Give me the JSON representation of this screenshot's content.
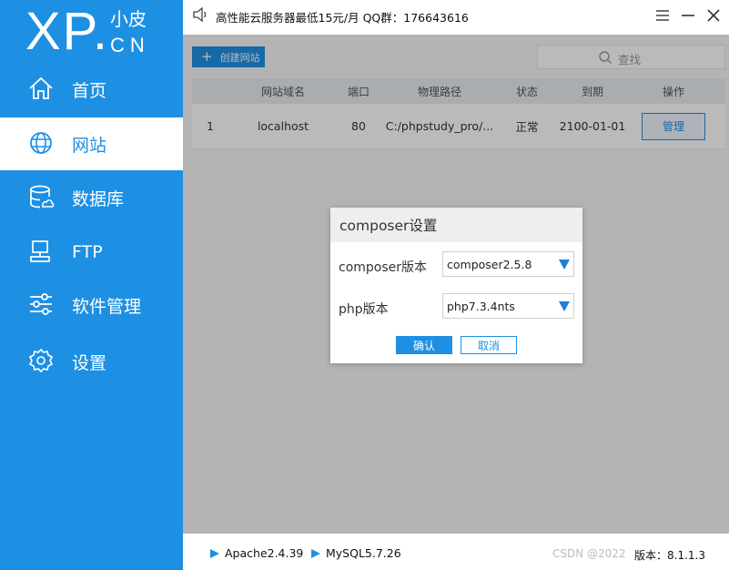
{
  "logo": {
    "main": "XP.",
    "cn_top": "小皮",
    "cn_bottom": "CN"
  },
  "sidebar": {
    "items": [
      {
        "label": "首页",
        "icon": "home-icon"
      },
      {
        "label": "网站",
        "icon": "globe-icon",
        "active": true
      },
      {
        "label": "数据库",
        "icon": "database-icon"
      },
      {
        "label": "FTP",
        "icon": "ftp-icon"
      },
      {
        "label": "软件管理",
        "icon": "sliders-icon"
      },
      {
        "label": "设置",
        "icon": "gear-icon"
      }
    ]
  },
  "topbar": {
    "notice": "高性能云服务器最低15元/月  QQ群：176643616",
    "icons": [
      "speaker-icon",
      "menu-icon",
      "minimize-icon",
      "close-icon"
    ]
  },
  "toolbar": {
    "create_label": "创建网站",
    "search_placeholder": "查找"
  },
  "table": {
    "headers": [
      "网站域名",
      "端口",
      "物理路径",
      "状态",
      "到期",
      "操作"
    ],
    "rows": [
      {
        "index": "1",
        "domain": "localhost",
        "port": "80",
        "path": "C:/phpstudy_pro/...",
        "status": "正常",
        "expiry": "2100-01-01",
        "action": "管理"
      }
    ]
  },
  "bottombar": {
    "services": [
      "Apache2.4.39",
      "MySQL5.7.26"
    ],
    "watermark": "CSDN @2022",
    "version": "版本：8.1.1.3"
  },
  "modal": {
    "title": "composer设置",
    "composer_label": "composer版本",
    "composer_value": "composer2.5.8",
    "php_label": "php版本",
    "php_value": "php7.3.4nts",
    "ok_label": "确认",
    "cancel_label": "取消"
  },
  "colors": {
    "accent": "#1e90e3",
    "sidebar_bg": "#1e90e3"
  }
}
